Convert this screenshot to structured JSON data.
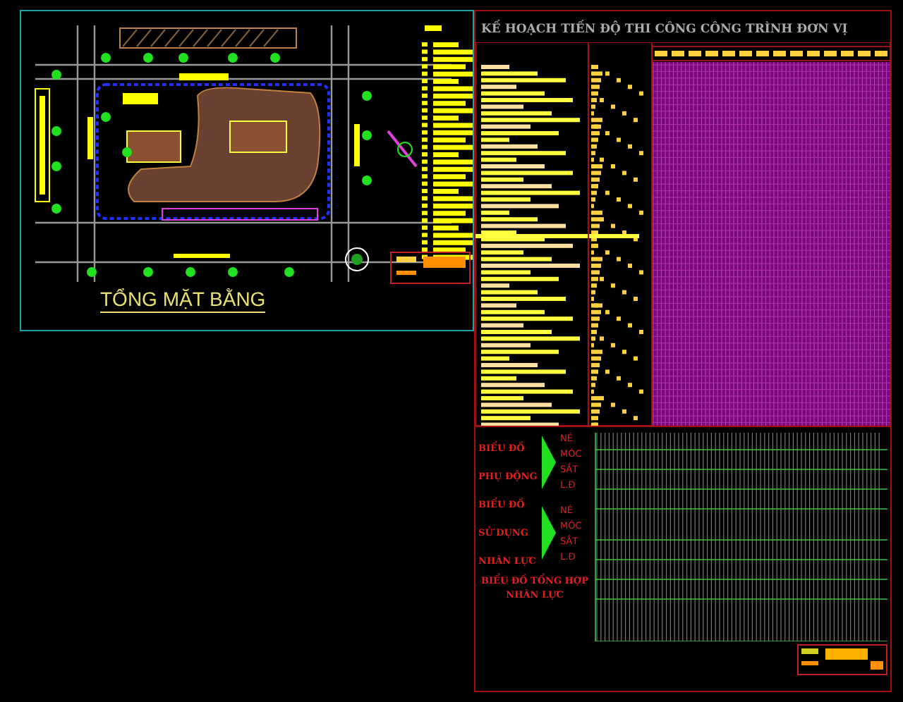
{
  "site_plan": {
    "title": "TỔNG MẶT BẰNG"
  },
  "schedule": {
    "title": "KẾ HOẠCH TIẾN ĐỘ THI CÔNG CÔNG TRÌNH ĐƠN VỊ"
  },
  "charts": [
    {
      "title_lines": [
        "BIỂU ĐỒ",
        "PHỤ ĐỘNG"
      ],
      "items": [
        "NÉ",
        "MÓC",
        "SẮT",
        "L.Đ"
      ]
    },
    {
      "title_lines": [
        "BIỂU ĐỒ",
        "SỬ DỤNG",
        "NHÂN LỰC"
      ],
      "items": [
        "NÉ",
        "MÓC",
        "SẮT",
        "L.Đ"
      ]
    }
  ],
  "summary": {
    "title_lines": [
      "BIỂU ĐỒ TỔNG HỢP",
      "NHÂN LỰC"
    ]
  }
}
